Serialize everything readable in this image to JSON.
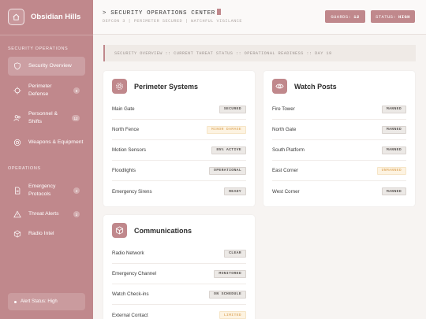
{
  "app": {
    "name": "Obsidian Hills"
  },
  "sidebar": {
    "section_security": "Security Operations",
    "section_operations": "Operations",
    "items": [
      {
        "label": "Security Overview",
        "icon": "shield-icon",
        "active": true
      },
      {
        "label": "Perimeter Defense",
        "icon": "crosshair-icon",
        "badge": "8"
      },
      {
        "label": "Personnel & Shifts",
        "icon": "users-icon",
        "badge": "12"
      },
      {
        "label": "Weapons & Equipment",
        "icon": "target-icon"
      },
      {
        "label": "Emergency Protocols",
        "icon": "document-icon",
        "badge": "4"
      },
      {
        "label": "Threat Alerts",
        "icon": "warning-icon",
        "badge": "2"
      },
      {
        "label": "Radio Intel",
        "icon": "box-icon"
      }
    ],
    "alert_status": "Alert Status: High"
  },
  "header": {
    "title": "> SECURITY OPERATIONS CENTER",
    "subtitle": "DEFCON 3 | PERIMETER SECURED | WATCHFUL VIGILANCE",
    "guards_label": "GUARDS:",
    "guards_value": "12",
    "status_label": "STATUS:",
    "status_value": "HIGH"
  },
  "ticker": "SECURITY OVERVIEW :: CURRENT THREAT STATUS :: OPERATIONAL READINESS :: DAY 19",
  "cards": {
    "perimeter": {
      "title": "Perimeter Systems",
      "rows": [
        {
          "label": "Main Gate",
          "status": "SECURED"
        },
        {
          "label": "North Fence",
          "status": "MINOR DAMAGE"
        },
        {
          "label": "Motion Sensors",
          "status": "85% ACTIVE"
        },
        {
          "label": "Floodlights",
          "status": "OPERATIONAL"
        },
        {
          "label": "Emergency Sirens",
          "status": "READY"
        }
      ]
    },
    "watch": {
      "title": "Watch Posts",
      "rows": [
        {
          "label": "Fire Tower",
          "status": "MANNED"
        },
        {
          "label": "North Gate",
          "status": "MANNED"
        },
        {
          "label": "South Platform",
          "status": "MANNED"
        },
        {
          "label": "East Corner",
          "status": "UNMANNED"
        },
        {
          "label": "West Corner",
          "status": "MANNED"
        }
      ]
    },
    "comms": {
      "title": "Communications",
      "rows": [
        {
          "label": "Radio Network",
          "status": "CLEAR"
        },
        {
          "label": "Emergency Channel",
          "status": "MONITORED"
        },
        {
          "label": "Watch Check-ins",
          "status": "ON SCHEDULE"
        },
        {
          "label": "External Contact",
          "status": "LIMITED"
        }
      ]
    }
  },
  "colors": {
    "accent": "#c0888c",
    "warn_text": "#e3b576",
    "warn_bg": "#fdf3e1",
    "background": "#f7f4f2"
  }
}
